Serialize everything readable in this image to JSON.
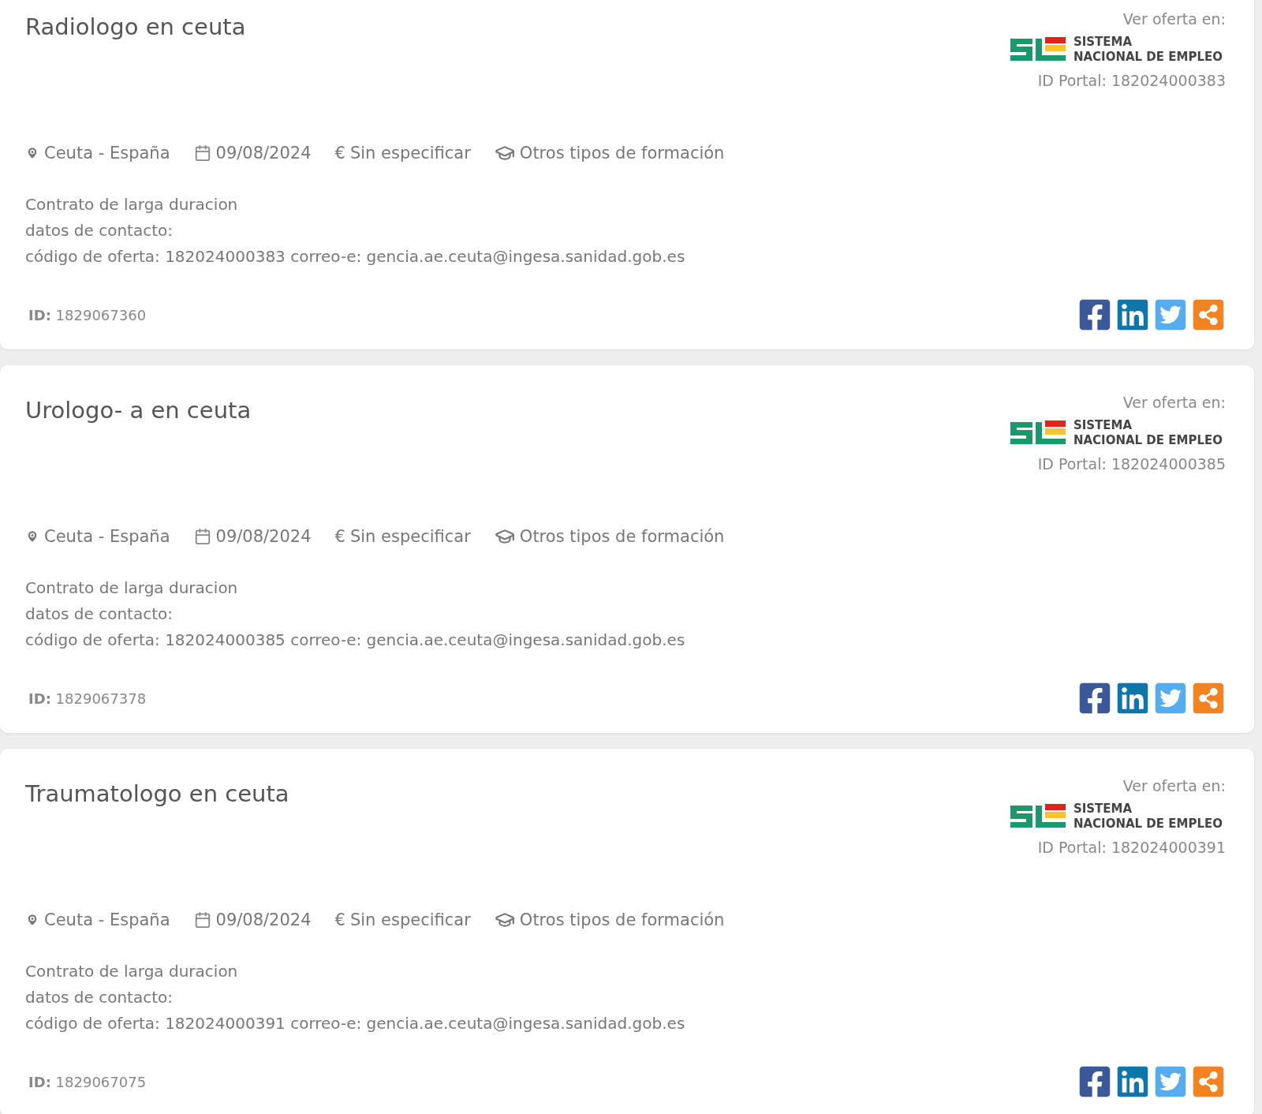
{
  "offers": [
    {
      "title": "Radiologo en ceuta",
      "location": "Ceuta - España",
      "date": "09/08/2024",
      "currency": "€",
      "salary": "Sin especificar",
      "education": "Otros tipos de formación",
      "description": [
        "Contrato de larga duracion",
        "datos de contacto:",
        "código de oferta: 182024000383 correo-e: gencia.ae.ceuta@ingesa.sanidad.gob.es"
      ],
      "source_label": "Ver oferta en:",
      "source_logo": [
        "SISTEMA",
        "NACIONAL DE EMPLEO"
      ],
      "portal_id": "ID Portal: 182024000383",
      "id_label": "ID:",
      "id": "1829067360",
      "share_buttons": [
        {
          "kind": "facebook"
        },
        {
          "kind": "linkedin"
        },
        {
          "kind": "twitter"
        },
        {
          "kind": "share"
        }
      ]
    },
    {
      "title": "Urologo- a en ceuta",
      "location": "Ceuta - España",
      "date": "09/08/2024",
      "currency": "€",
      "salary": "Sin especificar",
      "education": "Otros tipos de formación",
      "description": [
        "Contrato de larga duracion",
        "datos de contacto:",
        "código de oferta: 182024000385 correo-e: gencia.ae.ceuta@ingesa.sanidad.gob.es"
      ],
      "source_label": "Ver oferta en:",
      "source_logo": [
        "SISTEMA",
        "NACIONAL DE EMPLEO"
      ],
      "portal_id": "ID Portal: 182024000385",
      "id_label": "ID:",
      "id": "1829067378",
      "share_buttons": [
        {
          "kind": "facebook"
        },
        {
          "kind": "linkedin"
        },
        {
          "kind": "twitter"
        },
        {
          "kind": "share"
        }
      ]
    },
    {
      "title": "Traumatologo en ceuta",
      "location": "Ceuta - España",
      "date": "09/08/2024",
      "currency": "€",
      "salary": "Sin especificar",
      "education": "Otros tipos de formación",
      "description": [
        "Contrato de larga duracion",
        "datos de contacto:",
        "código de oferta: 182024000391 correo-e: gencia.ae.ceuta@ingesa.sanidad.gob.es"
      ],
      "source_label": "Ver oferta en:",
      "source_logo": [
        "SISTEMA",
        "NACIONAL DE EMPLEO"
      ],
      "portal_id": "ID Portal: 182024000391",
      "id_label": "ID:",
      "id": "1829067075",
      "share_buttons": [
        {
          "kind": "facebook"
        },
        {
          "kind": "linkedin"
        },
        {
          "kind": "twitter"
        },
        {
          "kind": "share"
        }
      ]
    }
  ]
}
